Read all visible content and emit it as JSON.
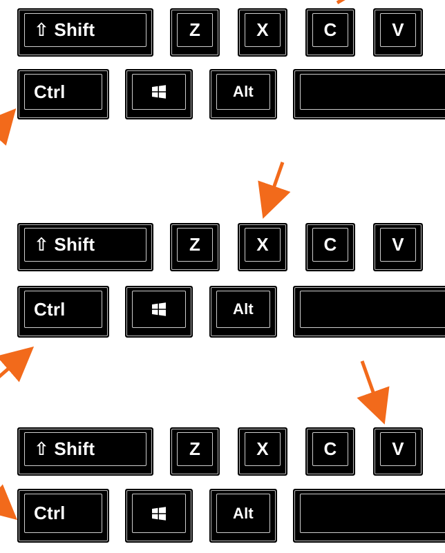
{
  "rows": [
    {
      "top": {
        "shift": "⇧ Shift",
        "z": "Z",
        "x": "X",
        "c": "C",
        "v": "V"
      },
      "bottom": {
        "ctrl": "Ctrl",
        "win": "windows-logo-icon",
        "alt": "Alt",
        "space": ""
      }
    },
    {
      "top": {
        "shift": "⇧ Shift",
        "z": "Z",
        "x": "X",
        "c": "C",
        "v": "V"
      },
      "bottom": {
        "ctrl": "Ctrl",
        "win": "windows-logo-icon",
        "alt": "Alt",
        "space": ""
      }
    },
    {
      "top": {
        "shift": "⇧ Shift",
        "z": "Z",
        "x": "X",
        "c": "C",
        "v": "V"
      },
      "bottom": {
        "ctrl": "Ctrl",
        "win": "windows-logo-icon",
        "alt": "Alt",
        "space": ""
      }
    }
  ],
  "colors": {
    "arrow": "#f26a1b",
    "key": "#000000",
    "background": "#ffffff"
  },
  "highlighted_keys": [
    {
      "row": 1,
      "keys": [
        "ctrl",
        "c"
      ]
    },
    {
      "row": 2,
      "keys": [
        "ctrl",
        "x"
      ]
    },
    {
      "row": 3,
      "keys": [
        "ctrl",
        "v"
      ]
    }
  ]
}
